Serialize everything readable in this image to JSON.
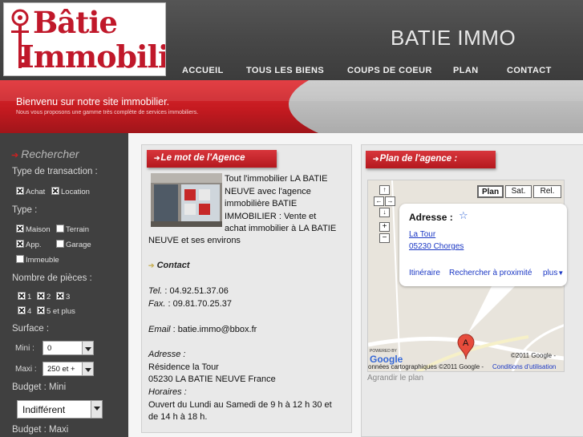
{
  "header": {
    "logo_line1": "Bâtie",
    "logo_line2": "Immobilier",
    "site_title": "BATIE IMMO",
    "nav": [
      "ACCUEIL",
      "TOUS LES BIENS",
      "COUPS DE COEUR",
      "PLAN",
      "CONTACT"
    ]
  },
  "banner": {
    "title": "Bienvenu sur notre site immobilier.",
    "subtitle": "Nous vous proposons une gamme très complète de services immobiliers."
  },
  "search": {
    "heading": "Rechercher",
    "transaction_label": "Type de transaction :",
    "transaction_options": [
      {
        "label": "Achat",
        "checked": true
      },
      {
        "label": "Location",
        "checked": true
      }
    ],
    "type_label": "Type :",
    "type_options": [
      {
        "label": "Maison",
        "checked": true
      },
      {
        "label": "Terrain",
        "checked": false
      },
      {
        "label": "App.",
        "checked": true
      },
      {
        "label": "Garage",
        "checked": false
      },
      {
        "label": "Immeuble",
        "checked": false
      }
    ],
    "rooms_label": "Nombre de pièces :",
    "rooms_options": [
      {
        "label": "1",
        "checked": true
      },
      {
        "label": "2",
        "checked": true
      },
      {
        "label": "3",
        "checked": true
      },
      {
        "label": "4",
        "checked": true
      },
      {
        "label": "5 et plus",
        "checked": true
      }
    ],
    "surface_label": "Surface :",
    "surface_min_label": "Mini :",
    "surface_min_value": "0",
    "surface_max_label": "Maxi :",
    "surface_max_value": "250 et +",
    "budget_min_label": "Budget : Mini",
    "budget_min_value": "Indifférent",
    "budget_max_label": "Budget : Maxi"
  },
  "agency": {
    "title": "Le mot de l'Agence",
    "intro": [
      "Tout l'immobilier LA BATIE",
      "NEUVE  avec l'agence",
      "immobilière BATIE",
      "IMMOBILIER : Vente et",
      "achat immobilier à LA BATIE",
      "NEUVE  et ses environs"
    ],
    "contact_heading": "Contact",
    "tel_label": "Tel.",
    "tel": ": 04.92.51.37.06",
    "fax_label": "Fax.",
    "fax": ": 09.81.70.25.37",
    "email_label": "Email",
    "email": ": batie.immo@bbox.fr",
    "address_label": "Adresse :",
    "address_line1": "Résidence la Tour",
    "address_line2": "05230 LA BATIE NEUVE France",
    "hours_label": "Horaires :",
    "hours_line1": "Ouvert du Lundi au Samedi de 9 h à 12 h 30 et",
    "hours_line2": "de 14 h à 18 h."
  },
  "plan": {
    "title": "Plan de l'agence :",
    "map_types": [
      "Plan",
      "Sat.",
      "Rel."
    ],
    "bubble_title": "Adresse :",
    "bubble_line1": "La Tour",
    "bubble_line2": "05230 Chorges",
    "bubble_link1": "Itinéraire",
    "bubble_link2": "Rechercher à proximité",
    "bubble_more": "plus",
    "marker": "A",
    "powered_by": "POWERED BY",
    "google": "Google",
    "copyright_small": "onnées cartographiques ©2011 Google -",
    "copyright_right": "©2011 Google -",
    "terms": "Conditions d'utilisation",
    "enlarge": "Agrandir le plan"
  }
}
